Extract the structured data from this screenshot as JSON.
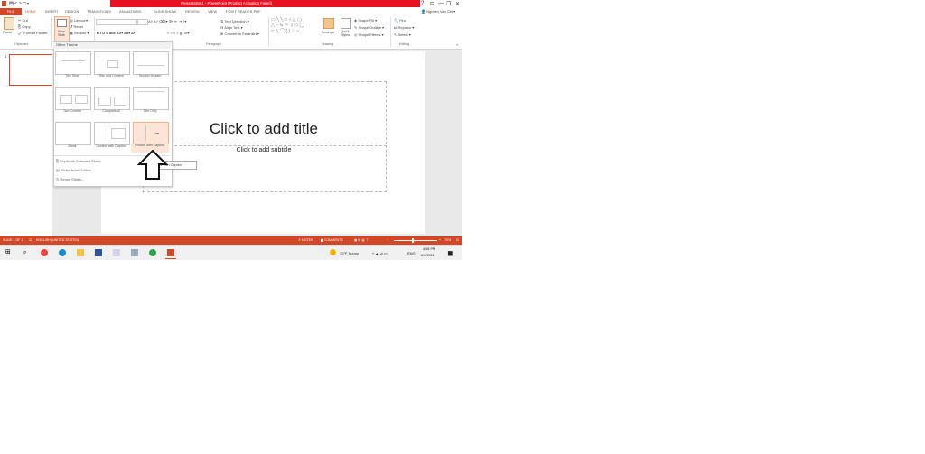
{
  "window": {
    "title": "Presentation1 - PowerPoint (Product Activation Failed)",
    "help": "?",
    "minimize": "—",
    "restore": "❐",
    "close": "✕"
  },
  "ribbon": {
    "tabs": [
      "FILE",
      "HOME",
      "INSERT",
      "DESIGN",
      "TRANSITIONS",
      "ANIMATIONS",
      "SLIDE SHOW",
      "REVIEW",
      "VIEW",
      "FOXIT READER PDF"
    ],
    "active_tab": "HOME",
    "user": "Nguyen Van Chi",
    "clipboard": {
      "cut": "Cut",
      "copy": "Copy",
      "paste": "Paste",
      "format_painter": "Format Painter",
      "label": "Clipboard"
    },
    "slides": {
      "new_slide": "New Slide",
      "layout": "Layout",
      "reset": "Reset",
      "section": "Section"
    },
    "paragraph": {
      "label": "Paragraph",
      "text_direction": "Text Direction",
      "align_text": "Align Text",
      "convert": "Convert to SmartArt"
    },
    "drawing": {
      "label": "Drawing",
      "arrange": "Arrange",
      "quick_styles": "Quick Styles",
      "shape_fill": "Shape Fill",
      "shape_outline": "Shape Outline",
      "shape_effects": "Shape Effects"
    },
    "editing": {
      "label": "Editing",
      "find": "Find",
      "replace": "Replace",
      "select": "Select"
    }
  },
  "gallery": {
    "header": "Office Theme",
    "layouts": [
      "Title Slide",
      "Title and Content",
      "Section Header",
      "Two Content",
      "Comparison",
      "Title Only",
      "Blank",
      "Content with Caption",
      "Picture with Caption"
    ],
    "selected": "Picture with Caption",
    "menu": [
      "Duplicate Selected Slides",
      "Slides from Outline...",
      "Reuse Slides..."
    ],
    "tooltip": "Picture with Caption"
  },
  "thumbnail": {
    "number": "1"
  },
  "slide": {
    "title_placeholder": "Click to add title",
    "subtitle_placeholder": "Click to add subtitle"
  },
  "status": {
    "slide": "SLIDE 1 OF 1",
    "language": "ENGLISH (UNITED STATES)",
    "notes": "NOTES",
    "comments": "COMMENTS",
    "zoom": "70%"
  },
  "taskbar": {
    "weather": "30°F Sunny",
    "lang": "ENG",
    "time": "4:58 PM",
    "date": "6/5/2021"
  },
  "colors": {
    "accent": "#d24726",
    "title_red": "#e81123",
    "selection": "#fce4d6"
  }
}
